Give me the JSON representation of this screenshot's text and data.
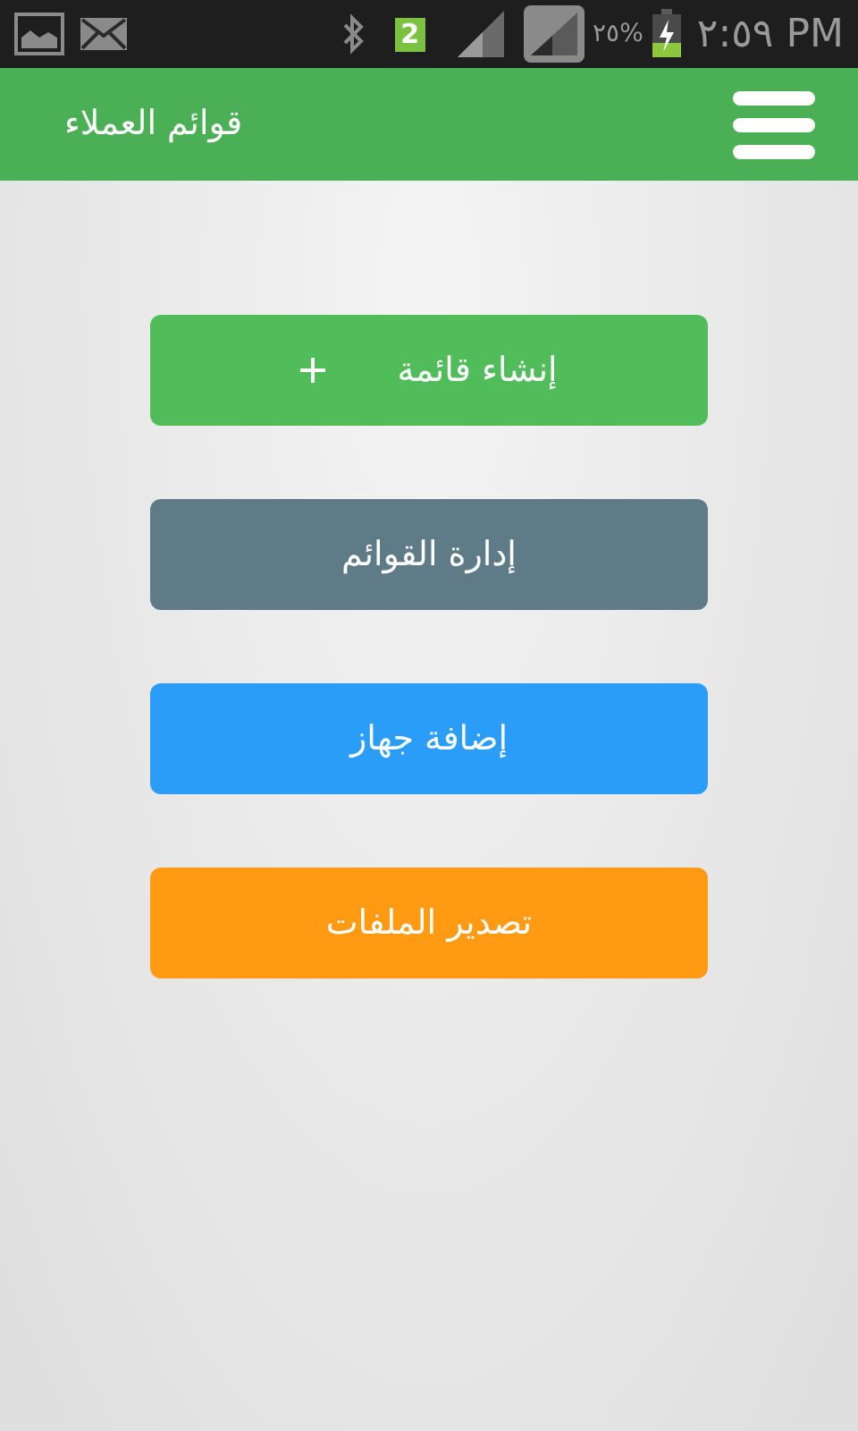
{
  "status_bar": {
    "sim_badge": "2",
    "battery_text": "٢٥%",
    "time": "٢:٥٩ PM"
  },
  "header": {
    "title": "قوائم العملاء"
  },
  "buttons": [
    {
      "label": "إنشاء قائمة",
      "color": "#50bd5a",
      "plus": true
    },
    {
      "label": "إدارة القوائم",
      "color": "#5f7b88",
      "plus": false
    },
    {
      "label": "إضافة جهاز",
      "color": "#2a9df8",
      "plus": false
    },
    {
      "label": "تصدير الملفات",
      "color": "#ff9a12",
      "plus": false
    }
  ]
}
